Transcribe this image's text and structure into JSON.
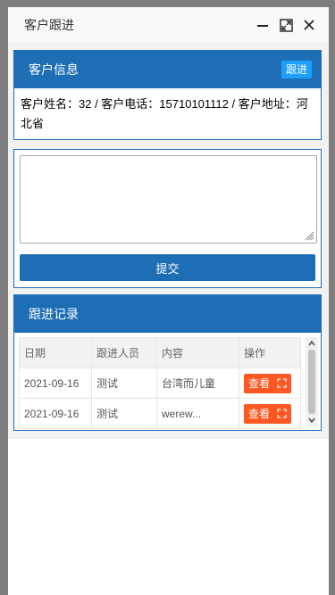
{
  "window": {
    "title": "客户跟进",
    "minimize_icon": "minimize-icon",
    "maximize_icon": "maximize-icon",
    "close_icon": "close-icon"
  },
  "customer_info": {
    "heading": "客户信息",
    "follow_button": "跟进",
    "detail": "客户姓名：32 / 客户电话：15710101112 / 客户地址：河北省"
  },
  "follow_form": {
    "textarea_value": "",
    "textarea_placeholder": "",
    "submit_label": "提交"
  },
  "records": {
    "heading": "跟进记录",
    "columns": [
      "日期",
      "跟进人员",
      "内容",
      "操作"
    ],
    "rows": [
      {
        "date": "2021-09-16",
        "person": "测试",
        "content": "台湾而儿童",
        "action": "查看"
      },
      {
        "date": "2021-09-16",
        "person": "测试",
        "content": "werew...",
        "action": "查看"
      }
    ]
  },
  "colors": {
    "primary": "#1e6eb5",
    "follow_button": "#1e9fff",
    "view_button": "#ff5722"
  }
}
